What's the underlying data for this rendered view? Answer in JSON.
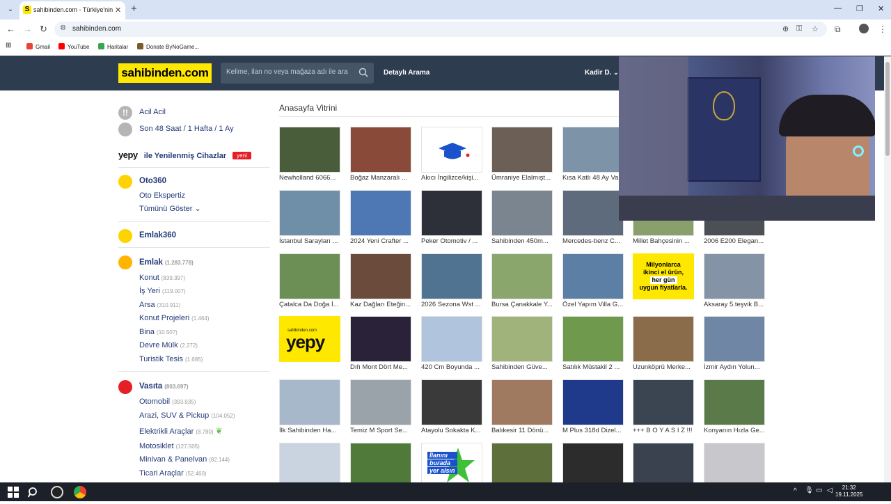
{
  "browser": {
    "tab_title": "sahibinden.com - Türkiye'nin O",
    "tab_favicon": "S",
    "url": "sahibinden.com",
    "bookmarks": [
      "Gmail",
      "YouTube",
      "Haritalar",
      "Donate ByNoGame..."
    ]
  },
  "header": {
    "logo": "sahibinden.com",
    "search_placeholder": "Kelime, ilan no veya mağaza adı ile ara",
    "detail_search": "Detaylı Arama",
    "user_name": "Kadir D."
  },
  "sidebar": {
    "urgent": "Acil Acil",
    "time_filters": [
      "Son 48 Saat",
      "1 Hafta",
      "1 Ay"
    ],
    "yepy_logo": "yepy",
    "yepy_text": "ile Yenilenmiş Cihazlar",
    "yepy_badge": "yeni",
    "oto360": "Oto360",
    "oto_expertise": "Oto Ekspertiz",
    "show_all": "Tümünü Göster",
    "emlak360": "Emlak360",
    "emlak": {
      "label": "Emlak",
      "count": "(1.283.778)"
    },
    "emlak_items": [
      {
        "label": "Konut",
        "count": "(839.397)"
      },
      {
        "label": "İş Yeri",
        "count": "(119.007)"
      },
      {
        "label": "Arsa",
        "count": "(310.911)"
      },
      {
        "label": "Konut Projeleri",
        "count": "(1.464)"
      },
      {
        "label": "Bina",
        "count": "(10.507)"
      },
      {
        "label": "Devre Mülk",
        "count": "(2.272)"
      },
      {
        "label": "Turistik Tesis",
        "count": "(1.685)"
      }
    ],
    "vasita": {
      "label": "Vasıta",
      "count": "(803.697)"
    },
    "vasita_items": [
      {
        "label": "Otomobil",
        "count": "(393.935)"
      },
      {
        "label": "Arazi, SUV & Pickup",
        "count": "(104.052)"
      },
      {
        "label": "Elektrikli Araçlar",
        "count": "(8.780)"
      },
      {
        "label": "Motosiklet",
        "count": "(127.505)"
      },
      {
        "label": "Minivan & Panelvan",
        "count": "(82.144)"
      },
      {
        "label": "Ticari Araçlar",
        "count": "(52.460)"
      }
    ]
  },
  "showcase": {
    "title": "Anasayfa Vitrini",
    "yepy_ad_logo": "yepy",
    "yepy_ad_small": "sahibinden.com",
    "promo_text": [
      "Milyonlarca",
      "ikinci el ürün,",
      "her gün",
      "uygun fiyatlarla."
    ],
    "ilan_text": [
      "İlanını",
      "burada",
      "yer alsın"
    ],
    "rows": [
      [
        "Newholland 6066...",
        "Boğaz Manzaralı ...",
        "Akıcı İngilizce/kişi...",
        "Ümraniye Elalmışt...",
        "Kısa Katlı 48 Ay Va...",
        "",
        ""
      ],
      [
        "İstanbul Sarayları ...",
        "2024 Yeni Crafter ...",
        "Peker Otomotiv / ...",
        "Sahibinden 450m...",
        "Mercedes-benz C...",
        "Millet Bahçesinin ...",
        "2006 E200 Elegan..."
      ],
      [
        "Çatalca Da Doğa İ...",
        "Kaz Dağları Eteğin...",
        "2026 Sezona Wst ...",
        "Bursa Çanakkale Y...",
        "Özel Yapım Villa G...",
        "",
        "Aksaray 5.teşvik B..."
      ],
      [
        "",
        "Dıfı Mont Dört Me...",
        "420 Cm Boyunda ...",
        "Sahibinden Güve...",
        "Satılık Müstakil 2 ...",
        "Uzunköprü Merke...",
        "İzmir Aydın Yolun..."
      ],
      [
        "İlk Sahibinden Ha...",
        "Temiz M Sport Se...",
        "Atayolu Sokakta K...",
        "Balıkesir 11 Dönü...",
        "M Plus 318d Dizel...",
        "+++ B O Y A S I Z !!!",
        "Konyanın Hızla Ge..."
      ],
      [
        "",
        "",
        "",
        "",
        "",
        "",
        ""
      ]
    ]
  },
  "taskbar": {
    "time": "21:32",
    "date": "19.11.2025"
  }
}
